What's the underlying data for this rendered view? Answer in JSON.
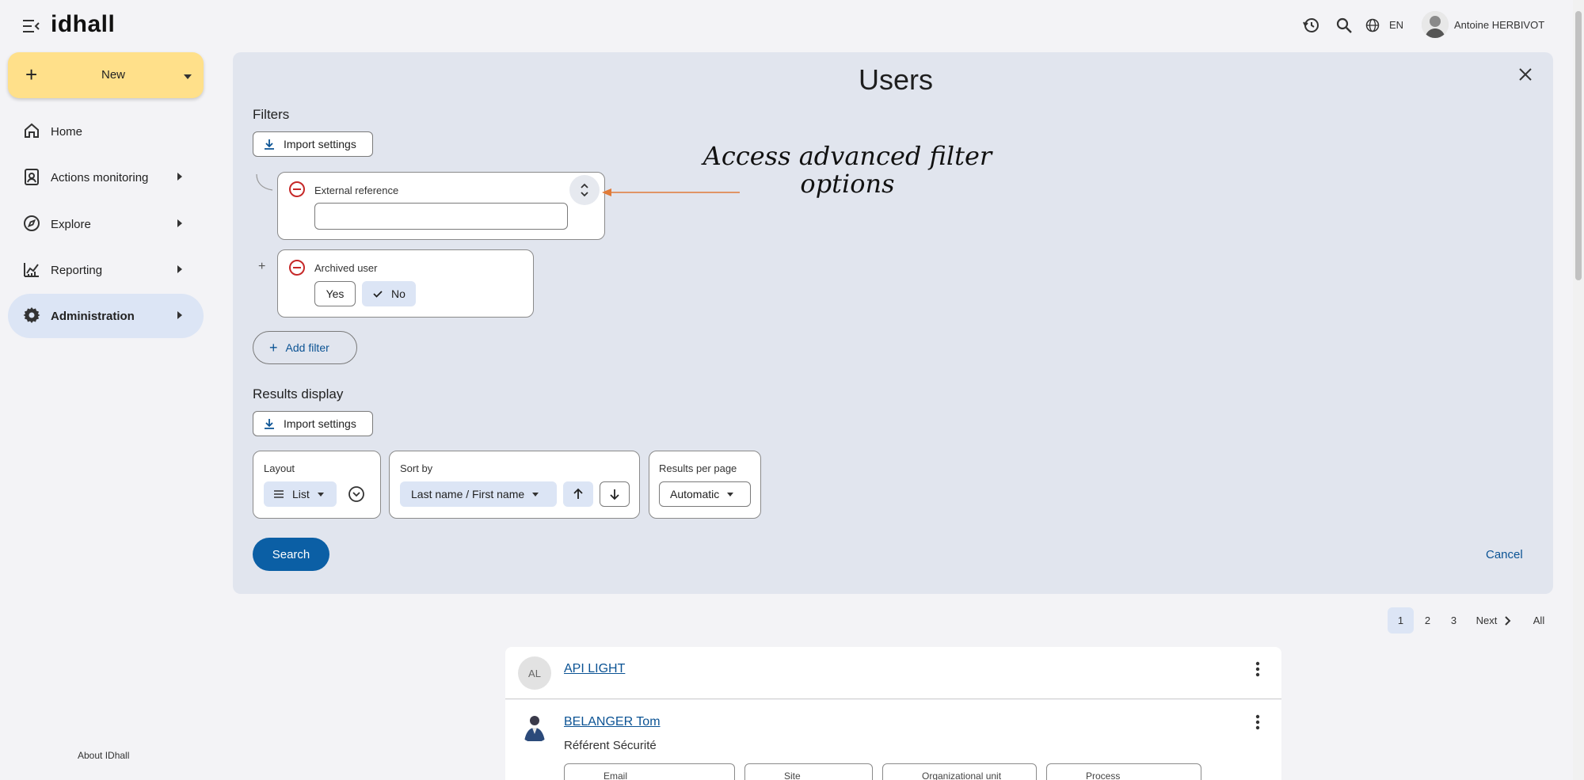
{
  "app": {
    "logo_text": "idhall"
  },
  "topbar": {
    "lang": "EN",
    "user_name": "Antoine HERBIVOT"
  },
  "sidebar": {
    "new_label": "New",
    "items": [
      {
        "label": "Home",
        "icon": "home-icon"
      },
      {
        "label": "Actions monitoring",
        "icon": "clipboard-user-icon"
      },
      {
        "label": "Explore",
        "icon": "compass-icon"
      },
      {
        "label": "Reporting",
        "icon": "chart-icon"
      },
      {
        "label": "Administration",
        "icon": "gear-icon"
      }
    ],
    "about": "About IDhall"
  },
  "main": {
    "title": "Users",
    "filters_title": "Filters",
    "import_settings": "Import settings",
    "filters": [
      {
        "label": "External reference",
        "value": ""
      },
      {
        "label": "Archived user",
        "options": [
          "Yes",
          "No"
        ],
        "selected": "No"
      }
    ],
    "add_filter": "Add filter",
    "results_display_title": "Results display",
    "import_settings_2": "Import settings",
    "layout": {
      "title": "Layout",
      "value": "List"
    },
    "sort_by": {
      "title": "Sort by",
      "value": "Last name / First name"
    },
    "results_per_page": {
      "title": "Results per page",
      "value": "Automatic"
    },
    "search": "Search",
    "cancel": "Cancel"
  },
  "annotation": {
    "line1": "Access advanced filter",
    "line2": "options"
  },
  "pagination": {
    "pages": [
      "1",
      "2",
      "3"
    ],
    "current": "1",
    "next": "Next",
    "all": "All"
  },
  "results": [
    {
      "initials": "AL",
      "name": "API LIGHT"
    },
    {
      "name": "BELANGER Tom",
      "role": "Référent Sécurité",
      "fields": [
        "Email",
        "Site",
        "Organizational unit",
        "Process"
      ]
    }
  ],
  "colors": {
    "accent": "#0b5fa5",
    "new_button": "#ffe08a",
    "active_nav": "#dce5f5",
    "panel": "#e1e5ee",
    "annotation_arrow": "#e07b39",
    "remove_icon": "#c62828"
  }
}
